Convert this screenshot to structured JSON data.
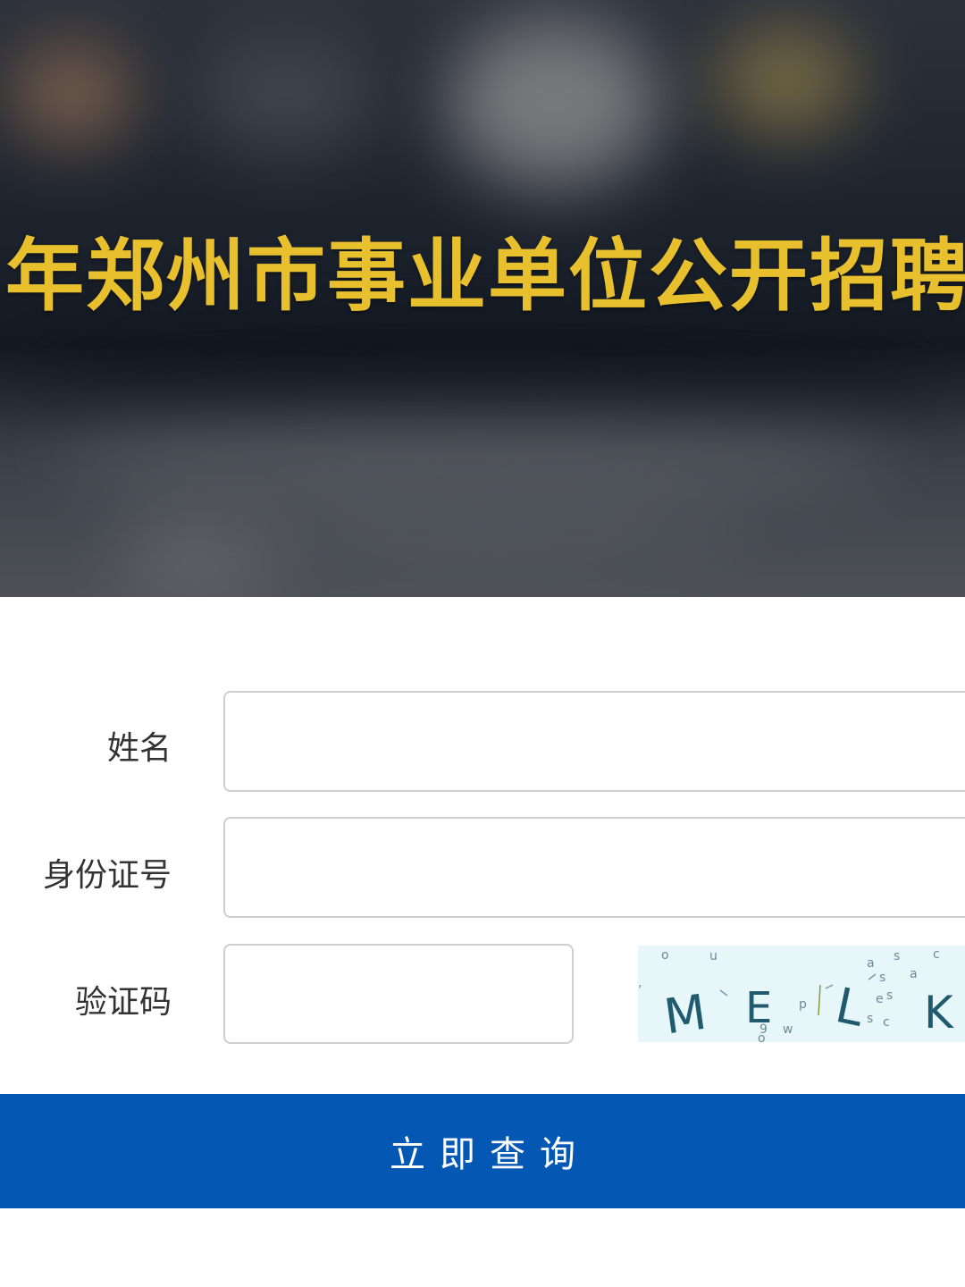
{
  "banner": {
    "title": "年郑州市事业单位公开招聘"
  },
  "form": {
    "name": {
      "label": "姓名",
      "value": "",
      "placeholder": ""
    },
    "id_number": {
      "label": "身份证号",
      "value": "",
      "placeholder": ""
    },
    "captcha": {
      "label": "验证码",
      "value": "",
      "placeholder": "",
      "image_text": "MELK",
      "image_letters": [
        "M",
        "E",
        "L",
        "K"
      ]
    }
  },
  "submit": {
    "label": "立即查询"
  },
  "colors": {
    "title": "#e8c02e",
    "button": "#0557b4",
    "captcha_bg": "#e7f6f9"
  }
}
